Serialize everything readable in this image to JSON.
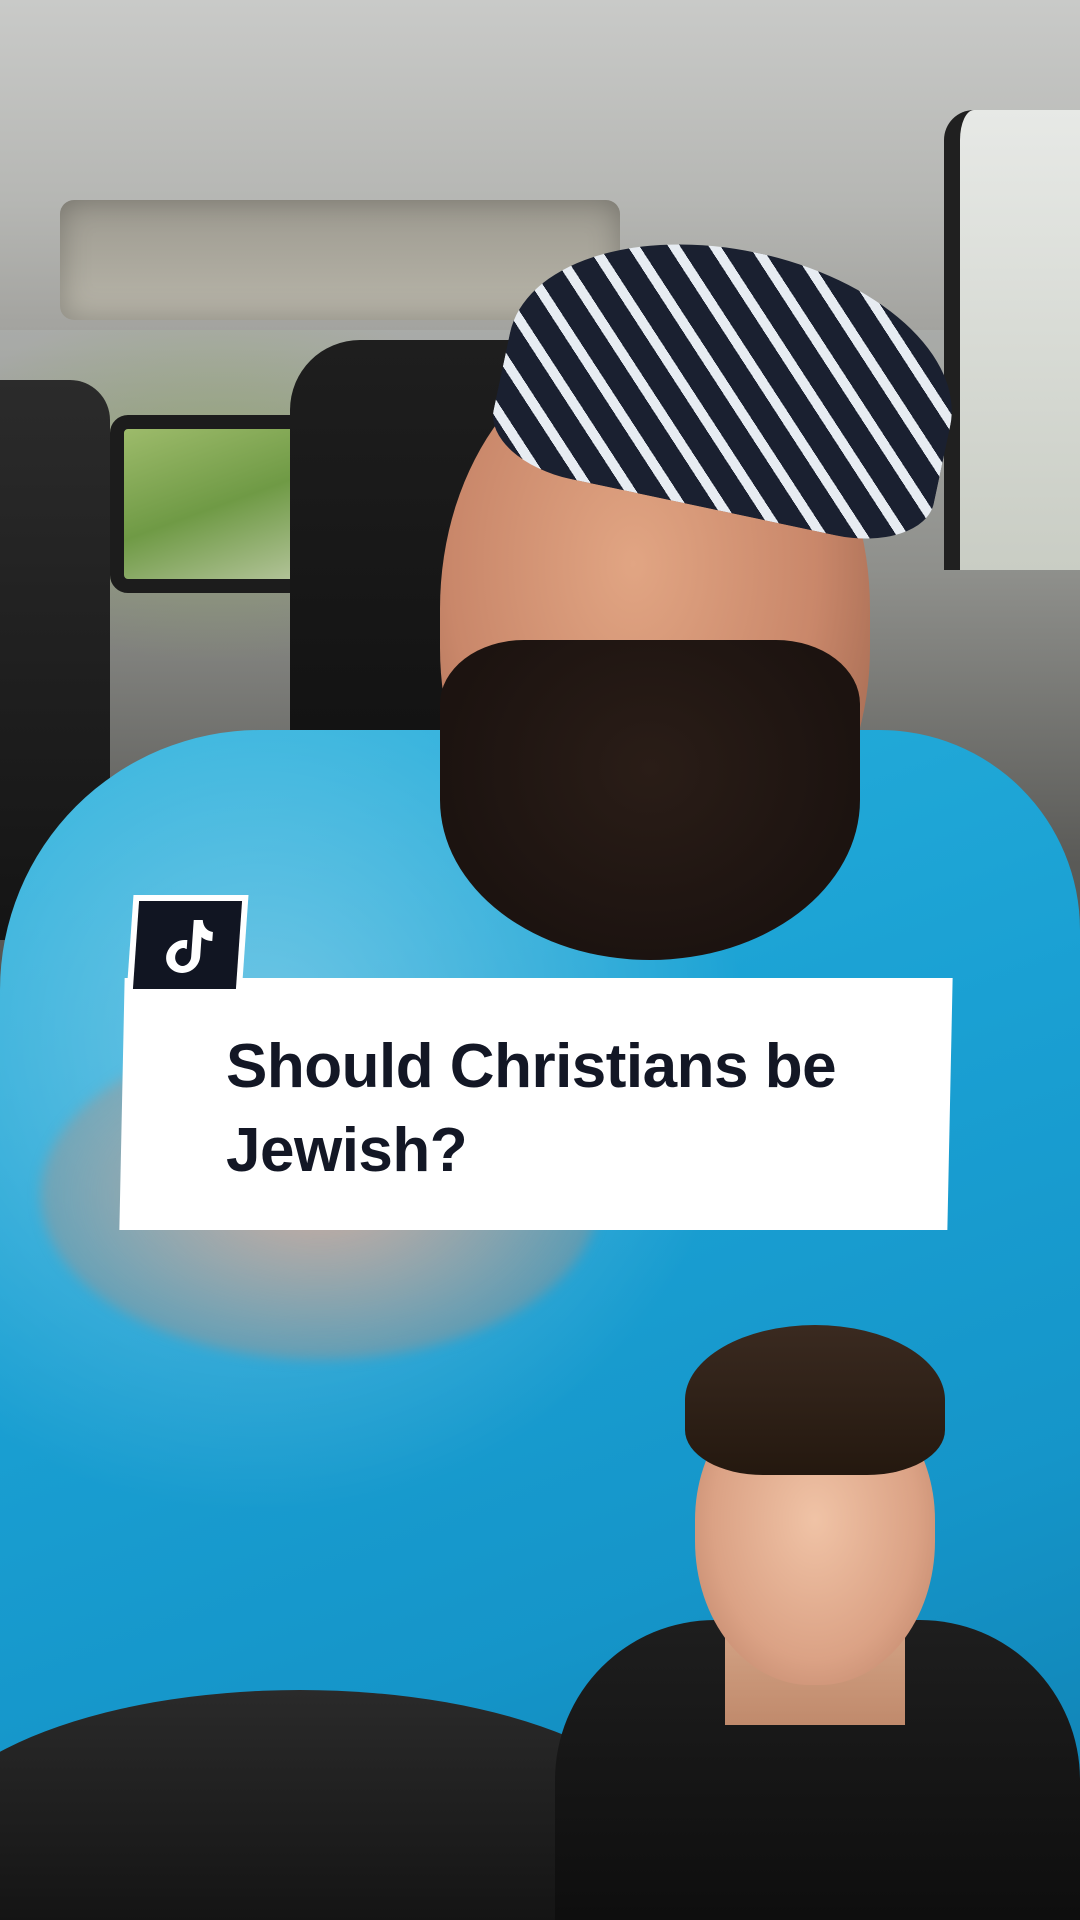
{
  "caption": {
    "text": "Should Christians be Jewish?"
  },
  "badge": {
    "icon": "tiktok-logo-icon"
  },
  "colors": {
    "caption_bg": "#ffffff",
    "caption_text": "#131725",
    "badge_bg": "#111522"
  }
}
